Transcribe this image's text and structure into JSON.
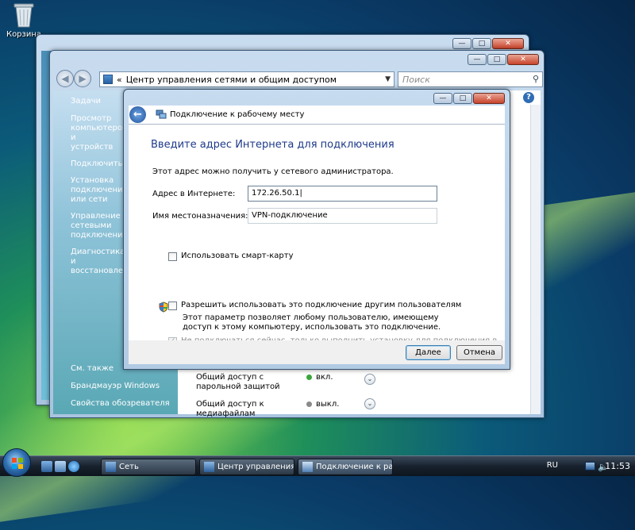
{
  "desktop": {
    "icon_label": "Корзина"
  },
  "explorer": {
    "address": "Центр управления сетями и общим доступом",
    "address_prefix": "«",
    "search_placeholder": "Поиск",
    "tasks_header": "Задачи",
    "tasks": [
      "Просмотр компьютеров и устройств",
      "Подключиться",
      "Установка подключения или сети",
      "Управление сетевыми подключениями",
      "Диагностика и восстановление"
    ],
    "see_also_header": "См. также",
    "see_also": [
      "Брандмауэр Windows",
      "Свойства обозревателя"
    ],
    "sharing": [
      {
        "label": "Общий доступ с парольной защитой",
        "state": "вкл.",
        "state_color": "#3aa63a"
      },
      {
        "label": "Общий доступ к медиафайлам",
        "state": "выкл.",
        "state_color": "#8a8a8a"
      }
    ]
  },
  "dialog": {
    "title": "Подключение к рабочему месту",
    "heading": "Введите адрес Интернета для подключения",
    "info": "Этот адрес можно получить у сетевого администратора.",
    "address_label": "Адрес в Интернете:",
    "address_value": "172.26.50.1",
    "dest_label": "Имя местоназначения:",
    "dest_value": "VPN-подключение",
    "smartcard_label": "Использовать смарт-карту",
    "smartcard_checked": false,
    "allow_others_label": "Разрешить использовать это подключение другим пользователям",
    "allow_others_checked": false,
    "allow_others_note": "Этот параметр позволяет любому пользователю, имеющему доступ к этому компьютеру, использовать это подключение.",
    "dont_connect_label": "Не подключаться сейчас, только выполнить установку для подключения в будущем",
    "dont_connect_checked": true,
    "dont_connect_enabled": false,
    "next_button": "Далее",
    "cancel_button": "Отмена"
  },
  "taskbar": {
    "buttons": [
      "Сеть",
      "Центр управления ...",
      "Подключение к ра..."
    ],
    "active_button": 2,
    "language": "RU",
    "clock": "11:53"
  }
}
